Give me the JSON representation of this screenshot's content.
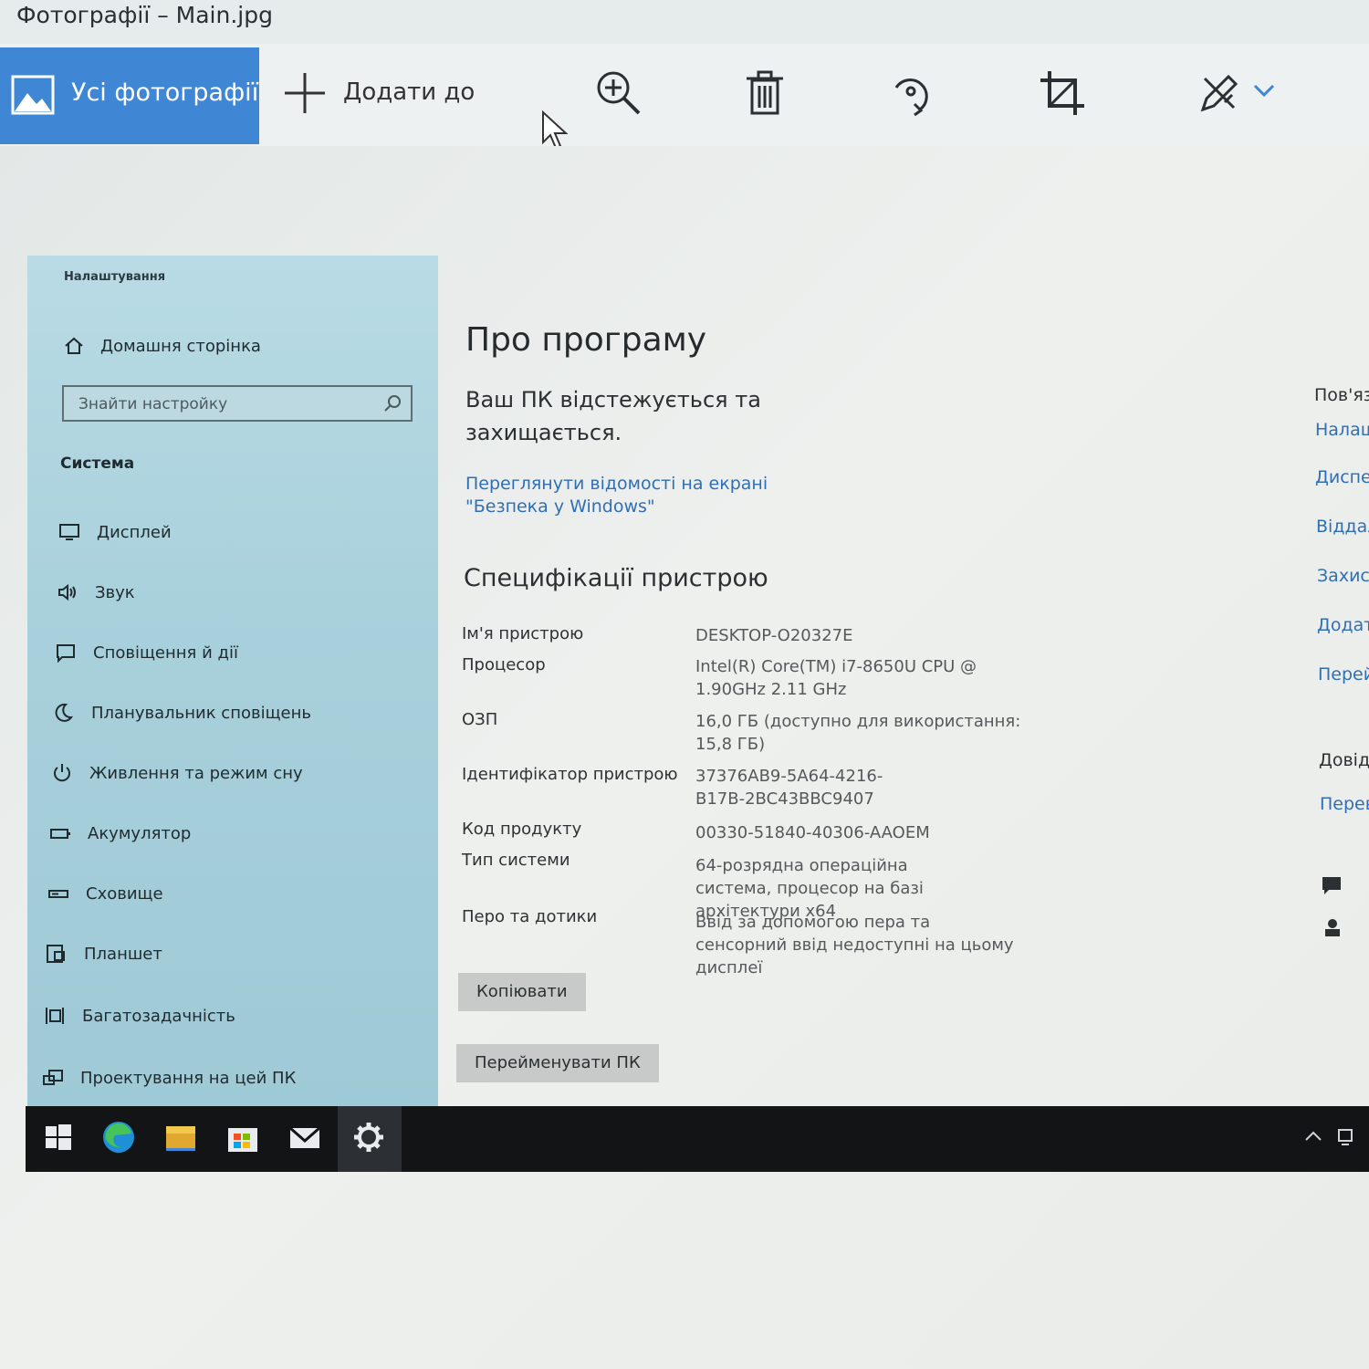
{
  "window": {
    "title": "Фотографії – Main.jpg"
  },
  "toolbar": {
    "all_photos": "Усі фотографії",
    "add_to": "Додати до",
    "icons": [
      "zoom-in-icon",
      "delete-icon",
      "rotate-icon",
      "crop-icon",
      "edit-icon",
      "chevron-down-icon"
    ]
  },
  "settings": {
    "app_title": "Налаштування",
    "home": "Домашня сторінка",
    "search_placeholder": "Знайти настройку",
    "section": "Система",
    "nav": [
      {
        "label": "Дисплей",
        "icon": "monitor-icon"
      },
      {
        "label": "Звук",
        "icon": "speaker-icon"
      },
      {
        "label": "Сповіщення й дії",
        "icon": "notification-icon"
      },
      {
        "label": "Планувальник сповіщень",
        "icon": "moon-icon"
      },
      {
        "label": "Живлення та режим сну",
        "icon": "power-icon"
      },
      {
        "label": "Акумулятор",
        "icon": "battery-icon"
      },
      {
        "label": "Сховище",
        "icon": "storage-icon"
      },
      {
        "label": "Планшет",
        "icon": "tablet-icon"
      },
      {
        "label": "Багатозадачність",
        "icon": "multitask-icon"
      },
      {
        "label": "Проектування на цей ПК",
        "icon": "project-icon"
      }
    ],
    "page_title": "Про програму",
    "status": "Ваш ПК відстежується та захищається.",
    "security_link": "Переглянути відомості на екрані \"Безпека у Windows\"",
    "specs_title": "Специфікації пристрою",
    "specs": [
      {
        "label": "Ім'я пристрою",
        "value": "DESKTOP-O20327E"
      },
      {
        "label": "Процесор",
        "value": "Intel(R) Core(TM) i7-8650U CPU @ 1.90GHz   2.11 GHz"
      },
      {
        "label": "ОЗП",
        "value": "16,0 ГБ (доступно для використання: 15,8 ГБ)"
      },
      {
        "label": "Ідентифікатор пристрою",
        "value": "37376AB9-5A64-4216-B17B-2BC43BBC9407"
      },
      {
        "label": "Код продукту",
        "value": "00330-51840-40306-AAOEM"
      },
      {
        "label": "Тип системи",
        "value": "64-розрядна операційна система, процесор на базі архітектури x64"
      },
      {
        "label": "Перо та дотики",
        "value": "Ввід за допомогою пера та сенсорний ввід недоступні на цьому дисплеї"
      }
    ],
    "copy_button": "Копіювати",
    "rename_button": "Перейменувати ПК",
    "right_links": {
      "related": "Пов'яз",
      "l1": "Налаш",
      "l2": "Диспе",
      "l3": "Віддал",
      "l4": "Захис",
      "l5": "Додат",
      "l6": "Перей",
      "help": "Довід",
      "l7": "Перев"
    }
  },
  "taskbar": {
    "apps": [
      "windows-start-icon",
      "edge-icon",
      "file-explorer-icon",
      "store-icon",
      "mail-icon",
      "settings-gear-icon"
    ],
    "colors": {
      "taskbar": "#121416",
      "accent": "#3f86d4",
      "link": "#2f6fb5"
    }
  }
}
